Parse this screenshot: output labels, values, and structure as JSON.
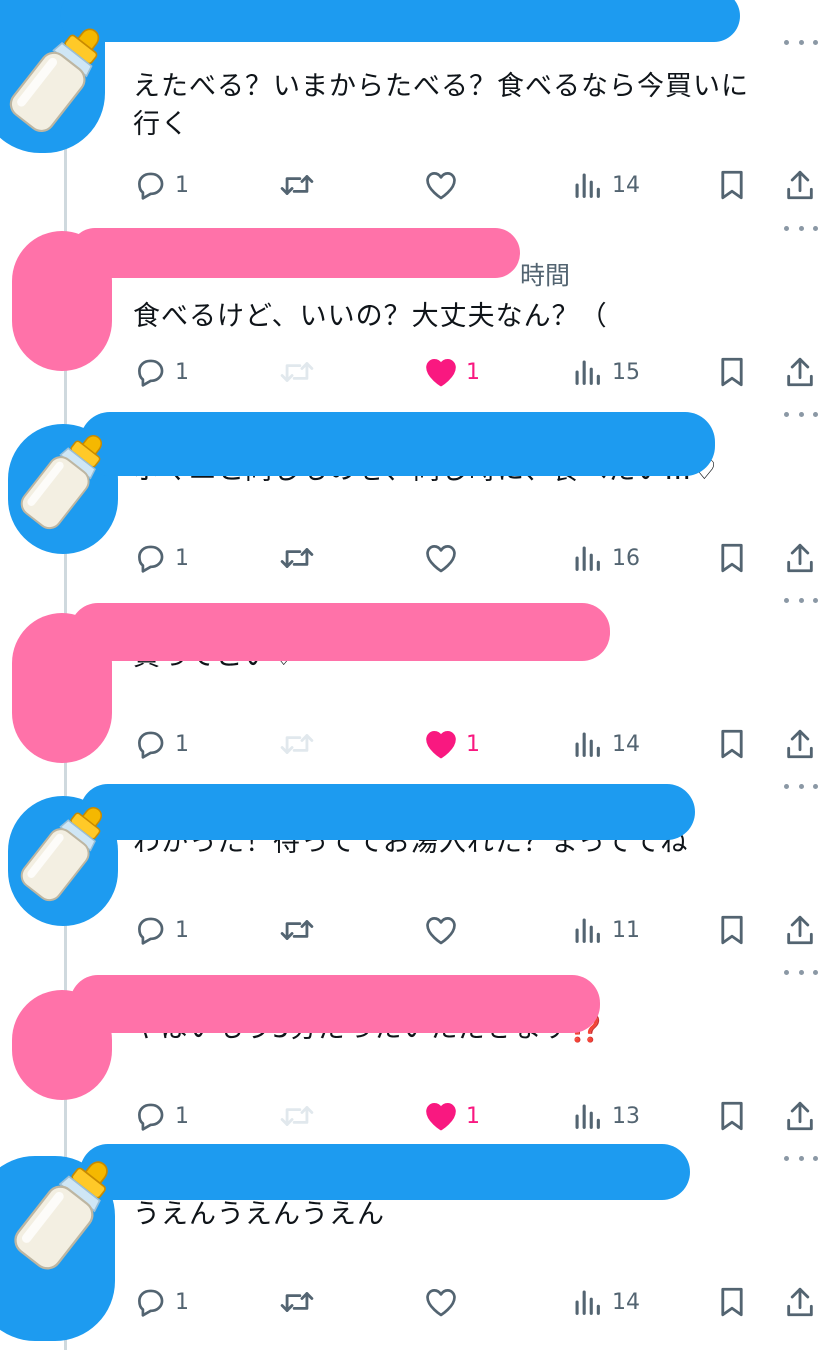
{
  "colors": {
    "accent_blue": "#1d9bf0",
    "like_pink": "#f91880",
    "scribble_pink": "#ff72a9",
    "muted": "#536471"
  },
  "tweets": [
    {
      "text": "えたべる？いまからたべる？食べるなら今買いに\n行く",
      "time": "",
      "replies": "1",
      "likes": "",
      "liked": false,
      "views": "14",
      "author": "bottle"
    },
    {
      "text": "食べるけど、いいの？大丈夫なん？（",
      "time": "時間",
      "replies": "1",
      "likes": "1",
      "liked": true,
      "views": "15",
      "author": "pink"
    },
    {
      "text": "ポマエと同じものを、同じ時に、食べたい…♡",
      "time": "",
      "replies": "1",
      "likes": "",
      "liked": false,
      "views": "16",
      "author": "bottle"
    },
    {
      "text": "買ってこい♡",
      "time": "",
      "replies": "1",
      "likes": "1",
      "liked": true,
      "views": "14",
      "author": "pink"
    },
    {
      "text": "わかった！待っててお湯入れた？まっててね",
      "time": "",
      "replies": "1",
      "likes": "",
      "liked": false,
      "views": "11",
      "author": "bottle"
    },
    {
      "text": "やばいもう5分だったいただきます⁉️",
      "time": "",
      "replies": "1",
      "likes": "1",
      "liked": true,
      "views": "13",
      "author": "pink"
    },
    {
      "text": "うえんうえんうえん",
      "time": "",
      "replies": "1",
      "likes": "",
      "liked": false,
      "views": "14",
      "author": "bottle"
    }
  ],
  "icons": {
    "reply": "reply-icon",
    "retweet": "retweet-icon",
    "like": "heart-icon",
    "views": "views-icon",
    "bookmark": "bookmark-icon",
    "share": "share-icon",
    "more": "more-icon",
    "avatar": "baby-bottle-icon"
  }
}
